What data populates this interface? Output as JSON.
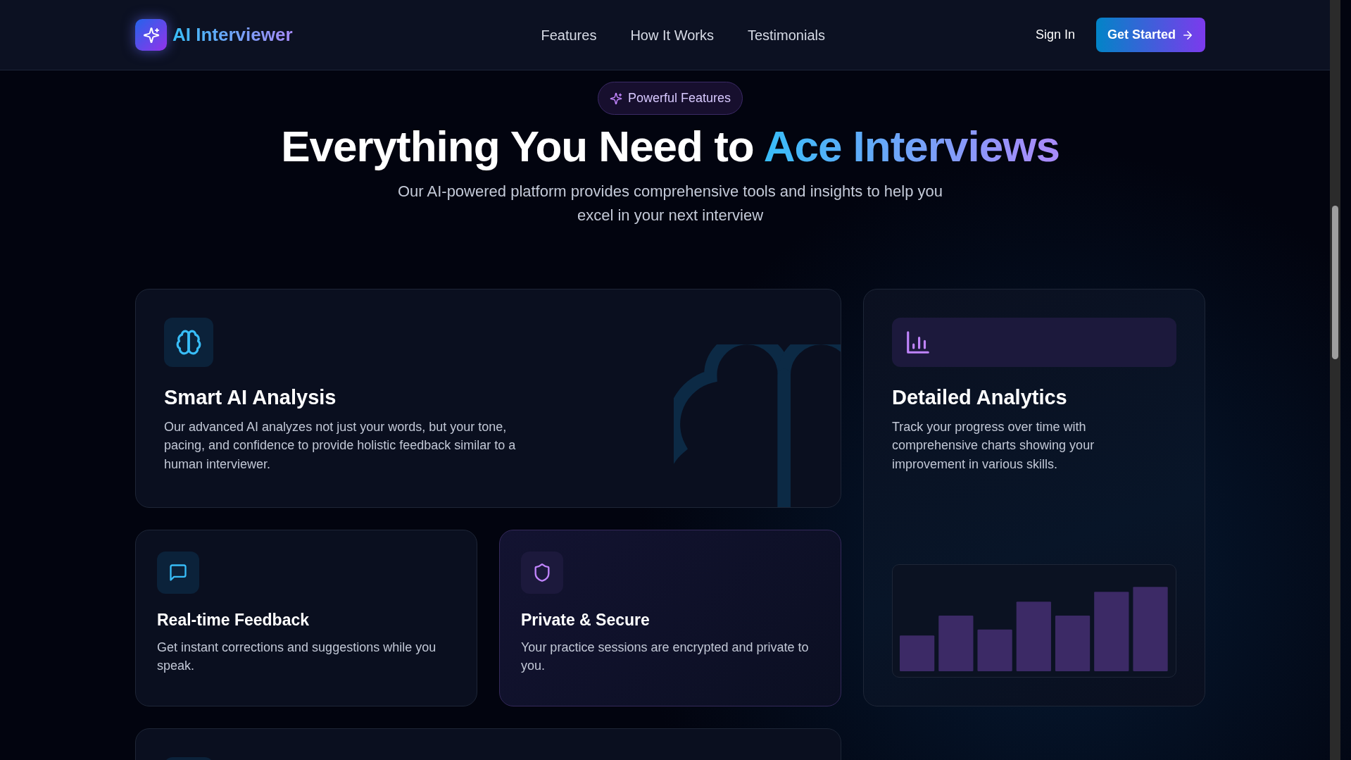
{
  "navbar": {
    "brand": "AI Interviewer",
    "links": [
      {
        "label": "Features"
      },
      {
        "label": "How It Works"
      },
      {
        "label": "Testimonials"
      }
    ],
    "sign_in": "Sign In",
    "cta": "Get Started"
  },
  "hero": {
    "badge": "Powerful Features",
    "title_plain": "Everything You Need to",
    "title_highlight": "Ace Interviews",
    "subtitle": "Our AI-powered platform provides comprehensive tools and insights to help you excel in your next interview"
  },
  "features": [
    {
      "kind": "wide",
      "title": "Smart AI Analysis",
      "text": "Our advanced AI analyzes not just your words, but your tone, pacing, and confidence to provide holistic feedback similar to a human interviewer."
    },
    {
      "kind": "tall",
      "title": "Detailed Analytics",
      "text": "Track your progress over time with comprehensive charts showing your improvement in various skills."
    },
    {
      "kind": "small",
      "title": "Real-time Feedback",
      "text": "Get instant corrections and suggestions while you speak."
    },
    {
      "kind": "small",
      "title": "Private & Secure",
      "text": "Your practice sessions are encrypted and private to you."
    },
    {
      "kind": "cut"
    }
  ]
}
